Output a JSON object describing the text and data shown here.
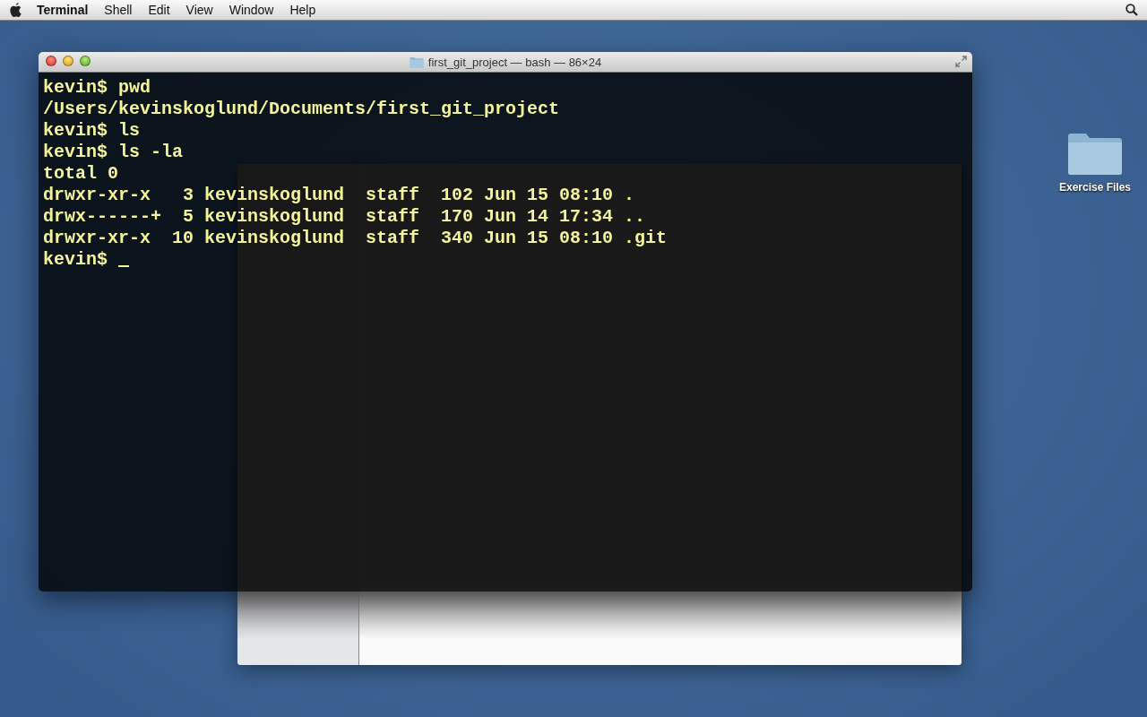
{
  "menu_bar": {
    "app": "Terminal",
    "items": [
      "Shell",
      "Edit",
      "View",
      "Window",
      "Help"
    ]
  },
  "terminal": {
    "title": "first_git_project — bash — 86×24",
    "cursor": true,
    "lines": [
      "kevin$ pwd",
      "/Users/kevinskoglund/Documents/first_git_project",
      "kevin$ ls",
      "kevin$ ls -la",
      "total 0",
      "drwxr-xr-x   3 kevinskoglund  staff  102 Jun 15 08:10 .",
      "drwx------+  5 kevinskoglund  staff  170 Jun 14 17:34 ..",
      "drwxr-xr-x  10 kevinskoglund  staff  340 Jun 15 08:10 .git",
      "kevin$ "
    ]
  },
  "desktop": {
    "icons": [
      {
        "label": "Exercise Files"
      }
    ]
  }
}
